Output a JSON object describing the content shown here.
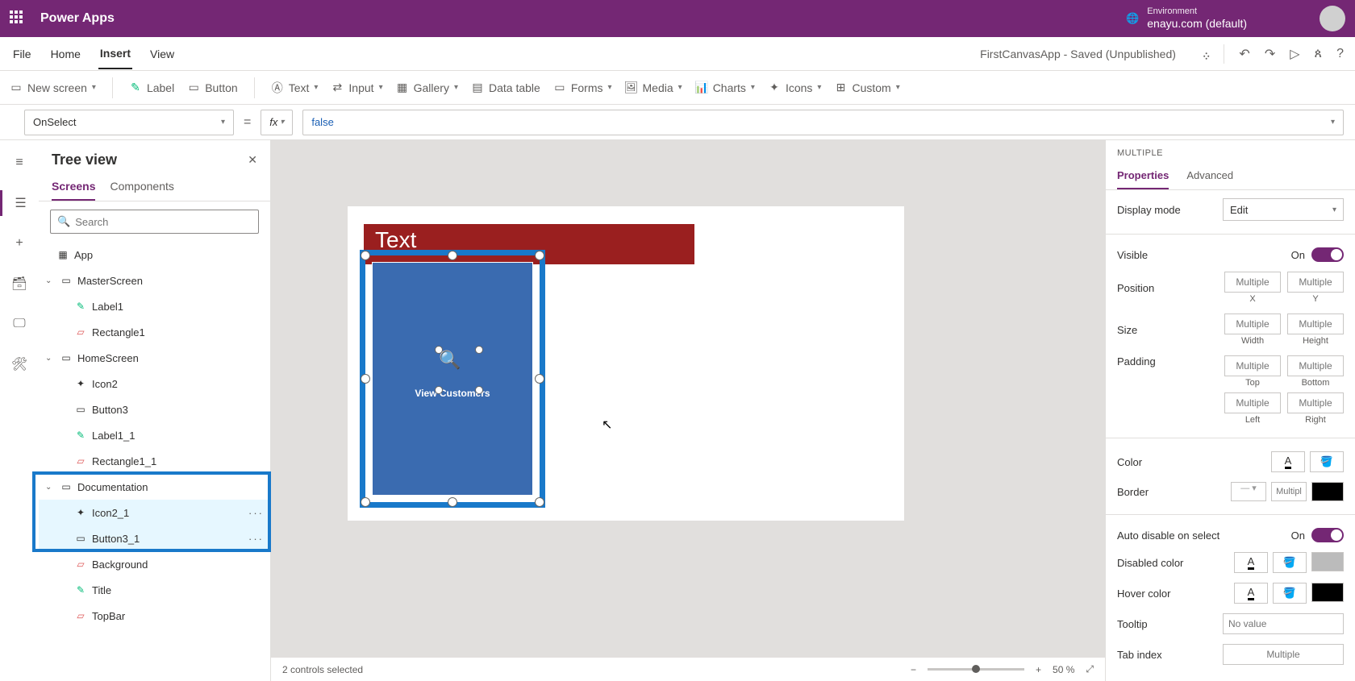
{
  "header": {
    "appTitle": "Power Apps",
    "envLabel": "Environment",
    "envName": "enayu.com (default)"
  },
  "menu": {
    "file": "File",
    "home": "Home",
    "insert": "Insert",
    "view": "View",
    "docTitle": "FirstCanvasApp - Saved (Unpublished)"
  },
  "ribbon": {
    "newScreen": "New screen",
    "label": "Label",
    "button": "Button",
    "text": "Text",
    "input": "Input",
    "gallery": "Gallery",
    "dataTable": "Data table",
    "forms": "Forms",
    "media": "Media",
    "charts": "Charts",
    "icons": "Icons",
    "custom": "Custom"
  },
  "formula": {
    "property": "OnSelect",
    "value": "false"
  },
  "tree": {
    "title": "Tree view",
    "tabScreens": "Screens",
    "tabComponents": "Components",
    "searchPlaceholder": "Search",
    "items": {
      "app": "App",
      "master": "MasterScreen",
      "label1": "Label1",
      "rect1": "Rectangle1",
      "home": "HomeScreen",
      "icon2": "Icon2",
      "button3": "Button3",
      "label11": "Label1_1",
      "rect11": "Rectangle1_1",
      "doc": "Documentation",
      "icon21": "Icon2_1",
      "button31": "Button3_1",
      "background": "Background",
      "titleItem": "Title",
      "topbar": "TopBar"
    }
  },
  "canvas": {
    "redText": "Text",
    "tileLabel": "View Customers",
    "statusText": "2 controls selected",
    "zoom": "50  %"
  },
  "props": {
    "title": "MULTIPLE",
    "tabProperties": "Properties",
    "tabAdvanced": "Advanced",
    "displayMode": "Display mode",
    "displayModeVal": "Edit",
    "visible": "Visible",
    "on": "On",
    "position": "Position",
    "size": "Size",
    "padding": "Padding",
    "multiple": "Multiple",
    "multipl": "Multipl",
    "x": "X",
    "y": "Y",
    "width": "Width",
    "height": "Height",
    "top": "Top",
    "bottom": "Bottom",
    "left": "Left",
    "right": "Right",
    "color": "Color",
    "border": "Border",
    "autoDisable": "Auto disable on select",
    "disabledColor": "Disabled color",
    "hoverColor": "Hover color",
    "tooltip": "Tooltip",
    "tooltipPh": "No value",
    "tabIndex": "Tab index"
  }
}
